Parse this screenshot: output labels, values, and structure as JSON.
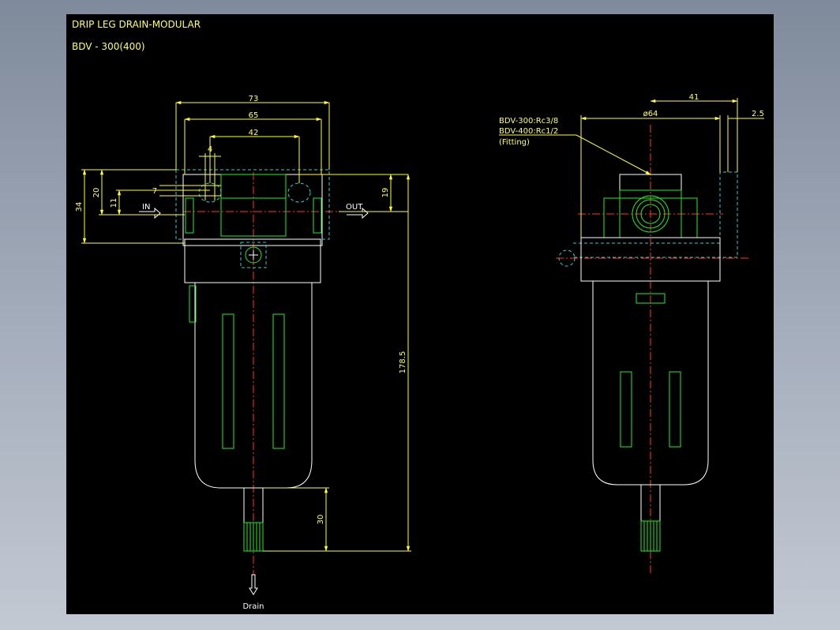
{
  "title": {
    "line1": "DRIP LEG DRAIN-MODULAR",
    "line2": "BDV - 300(400)"
  },
  "front_view": {
    "dims": {
      "width_73": "73",
      "width_65": "65",
      "width_42": "42",
      "width_4": "4",
      "height_34": "34",
      "height_20": "20",
      "height_11": "11",
      "offset_7": "7",
      "height_19": "19",
      "height_178_5": "178.5",
      "height_30": "30"
    },
    "labels": {
      "in": "IN",
      "out": "OUT",
      "drain": "Drain"
    }
  },
  "side_view": {
    "dims": {
      "width_41": "41",
      "dia_64": "ø64",
      "width_2_5": "2.5"
    },
    "callout": {
      "line1": "BDV-300:Rc3/8",
      "line2": "BDV-400:Rc1/2",
      "line3": "(Fitting)"
    }
  },
  "colors": {
    "background": "#000000",
    "dimension": "#ffff33",
    "outline": "#ffffff",
    "detail": "#22ee22",
    "hidden": "#33cccc",
    "centerline": "#ff3333"
  }
}
